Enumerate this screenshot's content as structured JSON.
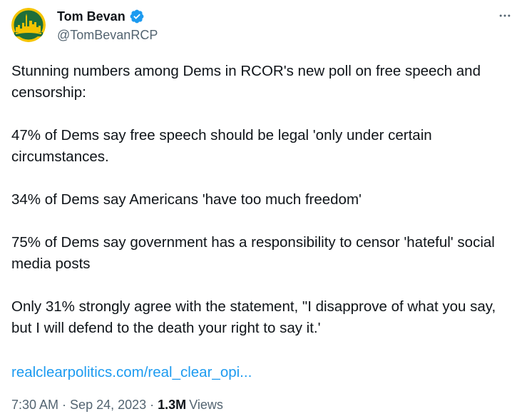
{
  "author": {
    "display_name": "Tom Bevan",
    "handle": "@TomBevanRCP",
    "verified": true,
    "verified_color": "#1d9bf0",
    "avatar_colors": {
      "bg": "#1f6f3a",
      "ring": "#f5c400",
      "skyline": "#f5c400"
    }
  },
  "tweet": {
    "paragraphs": [
      "Stunning numbers among Dems in RCOR's new poll on free speech and censorship:",
      "47% of Dems say free speech should be legal 'only under certain circumstances.",
      "34% of Dems say Americans 'have too much freedom'",
      "75% of Dems say government has a responsibility to censor 'hateful' social media posts",
      "Only 31% strongly agree with the statement, \"I disapprove of what you say, but I will defend to the death your right to say it.'"
    ],
    "link_text": "realclearpolitics.com/real_clear_opi..."
  },
  "meta": {
    "time": "7:30 AM",
    "separator": "·",
    "date": "Sep 24, 2023",
    "views_count": "1.3M",
    "views_label": "Views"
  },
  "icons": {
    "more": "more-horizontal-icon",
    "verified": "verified-badge-icon"
  }
}
